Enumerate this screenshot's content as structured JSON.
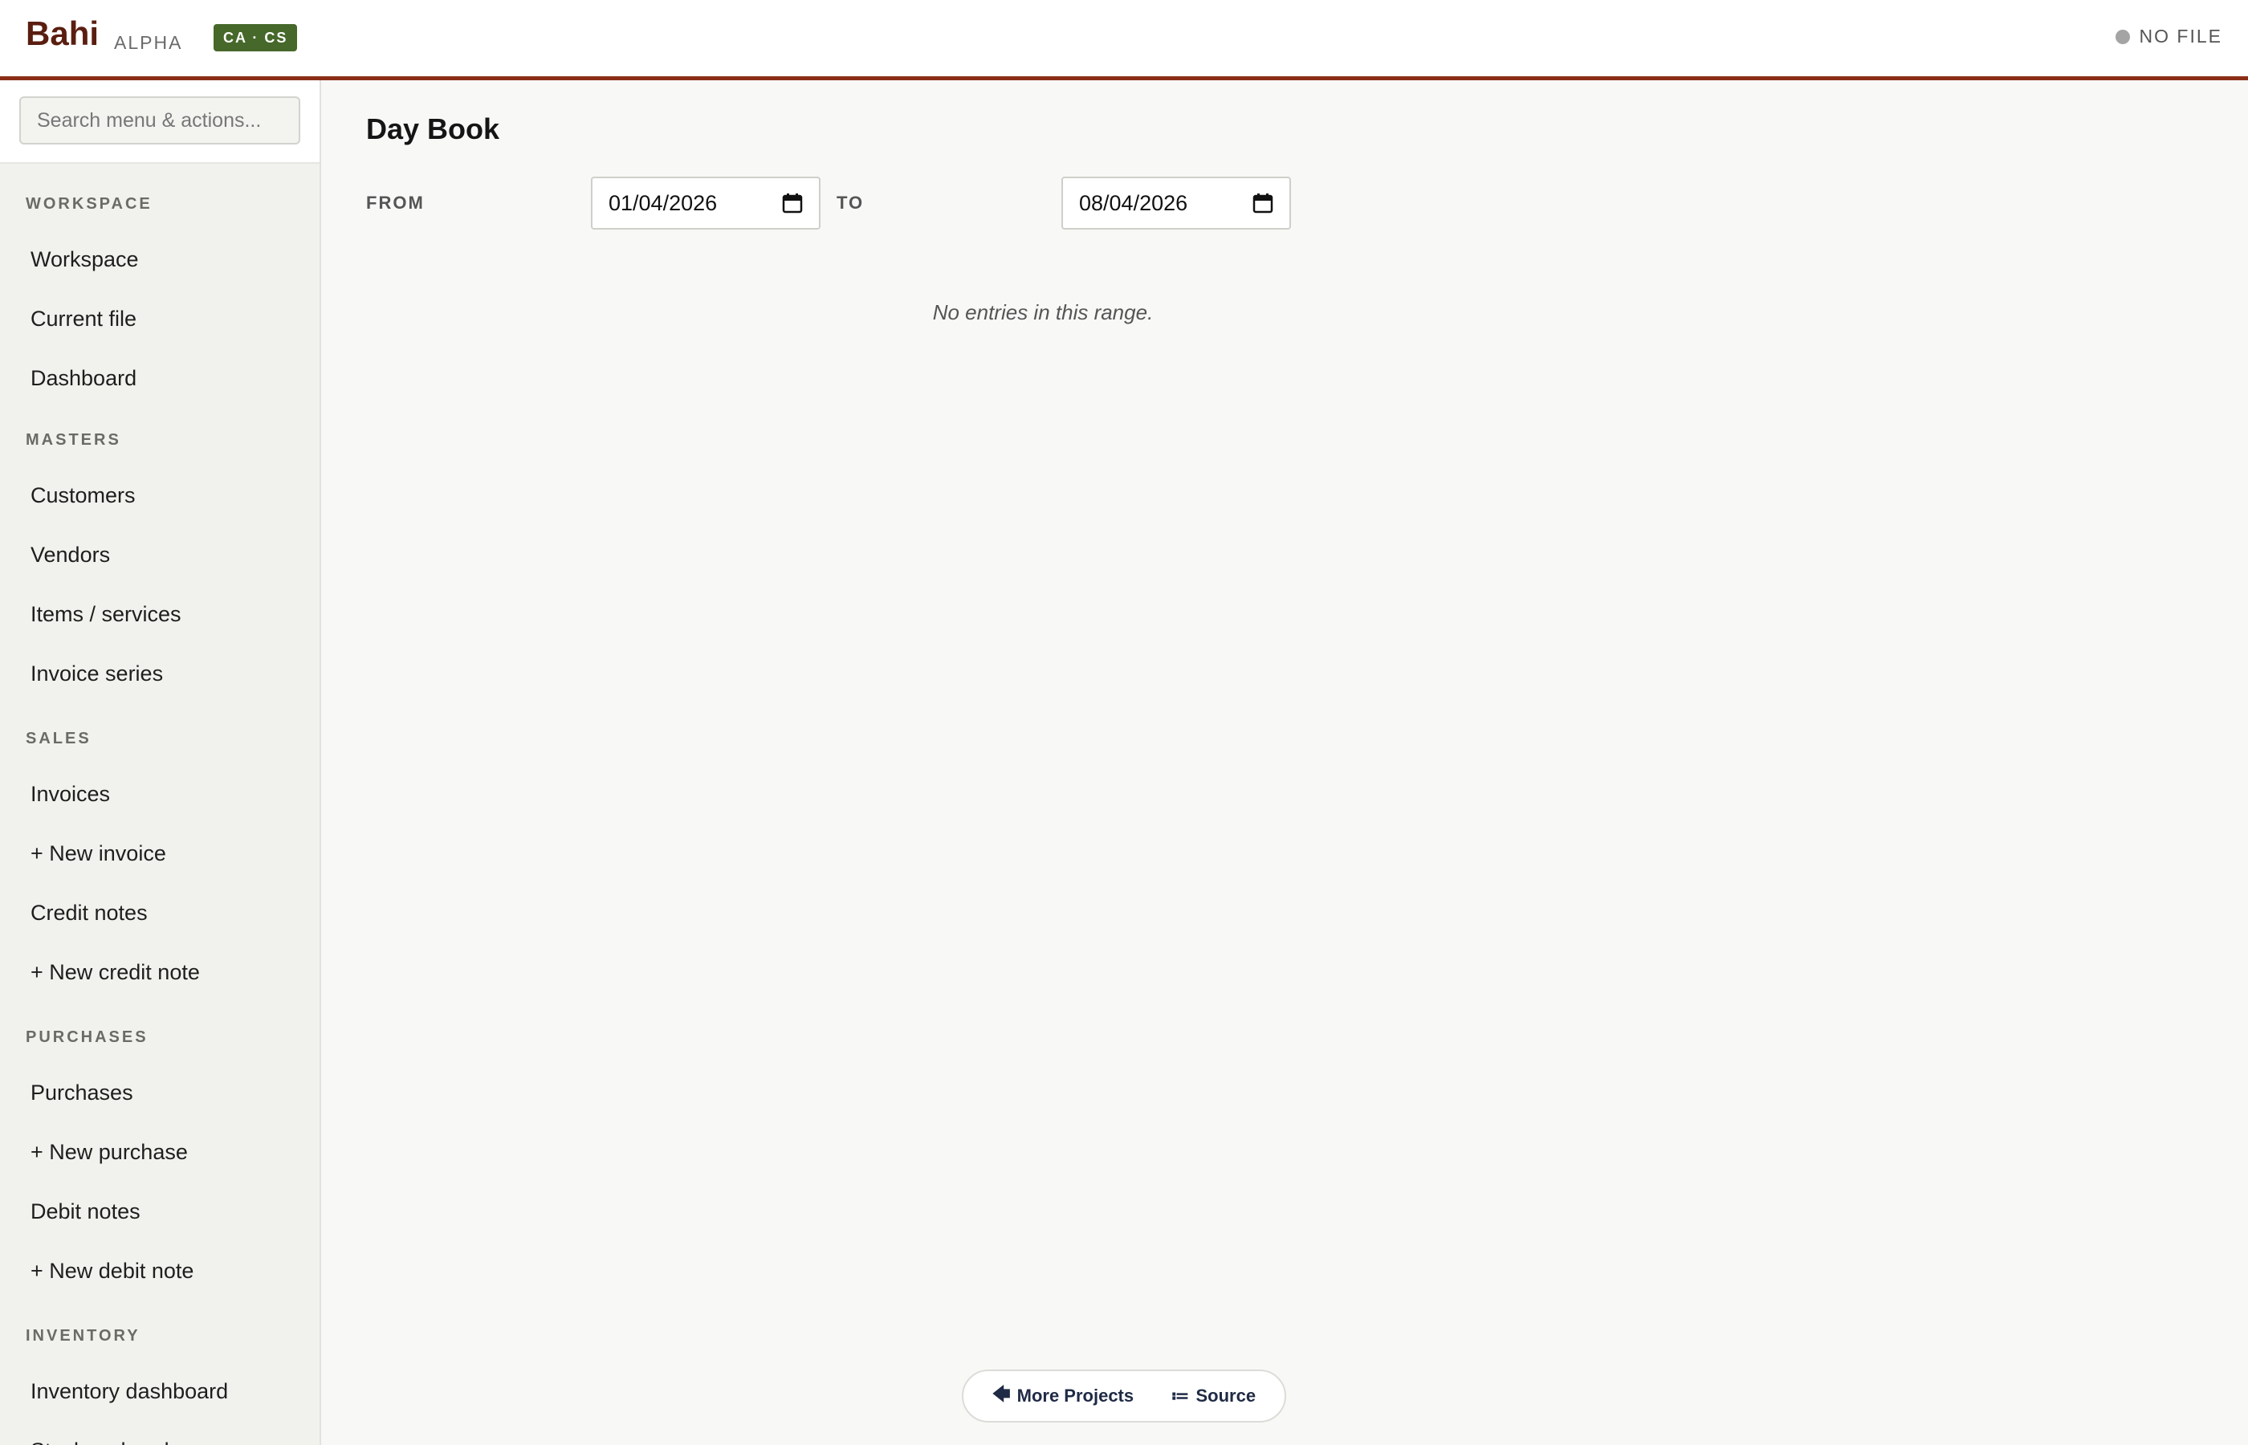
{
  "header": {
    "brand": "Bahi",
    "stage": "ALPHA",
    "badge": "CA · CS",
    "file_status": "NO FILE",
    "colors": {
      "brand": "#5a1e10",
      "accent_line": "#8b2e16",
      "badge_bg": "#46682a",
      "status_dot": "#a4a4a4"
    }
  },
  "sidebar": {
    "search_placeholder": "Search menu & actions...",
    "sections": {
      "workspace": {
        "title": "WORKSPACE",
        "items": [
          "Workspace",
          "Current file",
          "Dashboard"
        ]
      },
      "masters": {
        "title": "MASTERS",
        "items": [
          "Customers",
          "Vendors",
          "Items / services",
          "Invoice series"
        ]
      },
      "sales": {
        "title": "SALES",
        "items": [
          "Invoices",
          "+ New invoice",
          "Credit notes",
          "+ New credit note"
        ]
      },
      "purchases": {
        "title": "PURCHASES",
        "items": [
          "Purchases",
          "+ New purchase",
          "Debit notes",
          "+ New debit note"
        ]
      },
      "inventory": {
        "title": "INVENTORY",
        "items": [
          "Inventory dashboard",
          "Stock on hand"
        ]
      }
    }
  },
  "main": {
    "title": "Day Book",
    "from_label": "FROM",
    "to_label": "TO",
    "from_date": "01/04/2026",
    "to_date": "08/04/2026",
    "empty_message": "No entries in this range."
  },
  "footer": {
    "more_projects": "More Projects",
    "source": "Source",
    "icons": {
      "more_projects": "arrow-left-icon",
      "source": "code-icon"
    }
  }
}
